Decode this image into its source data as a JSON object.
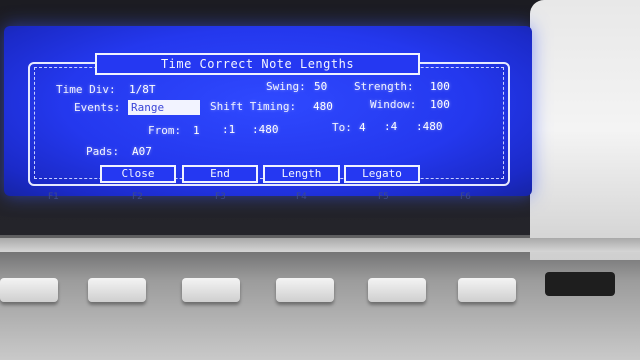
{
  "dialog": {
    "title": "Time Correct Note Lengths"
  },
  "fields": {
    "time_div_label": "Time Div:",
    "time_div_value": "1/8T",
    "swing_label": "Swing:",
    "swing_value": "50",
    "strength_label": "Strength:",
    "strength_value": "100",
    "events_label": "Events:",
    "events_value": "Range",
    "shift_timing_label": "Shift Timing:",
    "shift_timing_value": "480",
    "window_label": "Window:",
    "window_value": "100",
    "from_label": "From:",
    "from_bar": "1",
    "from_beat": ":1",
    "from_tick": ":480",
    "to_label": "To:",
    "to_bar": "4",
    "to_beat": ":4",
    "to_tick": ":480",
    "pads_label": "Pads:",
    "pads_value": "A07"
  },
  "softkeys": [
    {
      "label": "Close"
    },
    {
      "label": "End"
    },
    {
      "label": "Length"
    },
    {
      "label": "Legato"
    }
  ],
  "function_labels": [
    "F1",
    "F2",
    "F3",
    "F4",
    "F5",
    "F6"
  ],
  "colors": {
    "lcd_blue": "#2438ee",
    "lcd_text": "#f0f2ff",
    "selection_bg": "#f2f3ff"
  }
}
